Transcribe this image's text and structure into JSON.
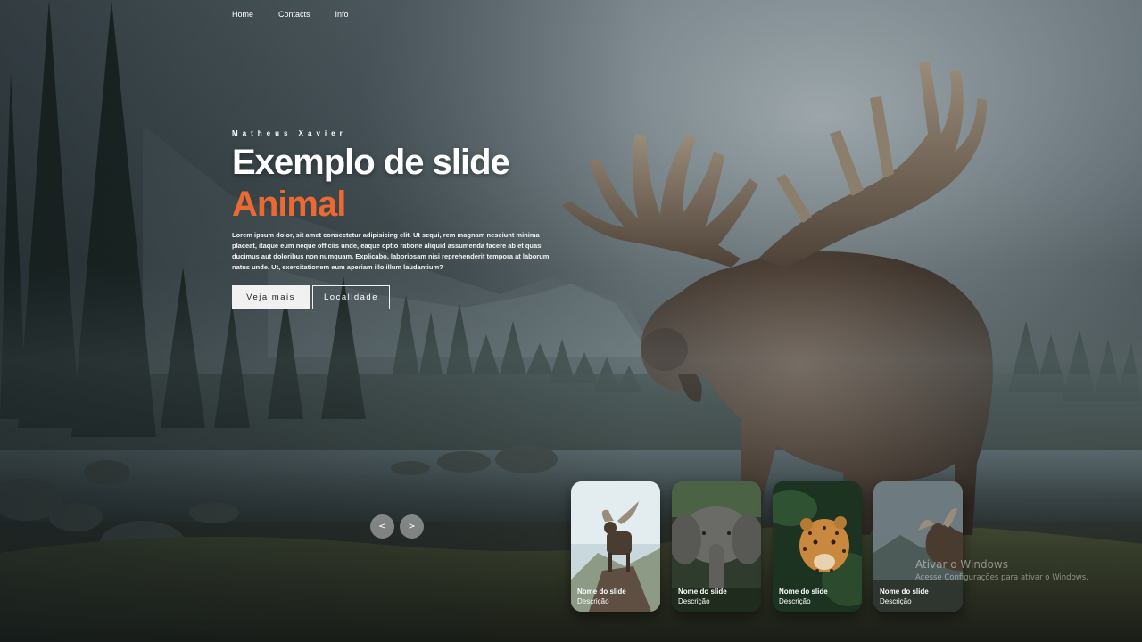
{
  "nav": {
    "items": [
      {
        "label": "Home"
      },
      {
        "label": "Contacts"
      },
      {
        "label": "Info"
      }
    ]
  },
  "hero": {
    "author": "Matheus Xavier",
    "title": "Exemplo de slide",
    "subtitle": "Animal",
    "description": "Lorem ipsum dolor, sit amet consectetur adipisicing elit. Ut sequi, rem magnam nesciunt minima placeat, itaque eum neque officiis unde, eaque optio ratione aliquid assumenda facere ab et quasi ducimus aut doloribus non numquam. Explicabo, laboriosam nisi reprehenderit tempora at laborum natus unde. Ut, exercitationem eum aperiam illo illum laudantium?",
    "primary_button": "Veja mais",
    "secondary_button": "Localidade",
    "accent_color": "#ec6a32"
  },
  "slider": {
    "prev_label": "<",
    "next_label": ">",
    "thumbnails": [
      {
        "name": "Nome do slide",
        "description": "Descrição",
        "image": "moose"
      },
      {
        "name": "Nome do slide",
        "description": "Descrição",
        "image": "elephant"
      },
      {
        "name": "Nome do slide",
        "description": "Descrição",
        "image": "jaguar"
      },
      {
        "name": "Nome do slide",
        "description": "Descrição",
        "image": "moose-antlers"
      }
    ]
  },
  "watermark": {
    "title": "Ativar o Windows",
    "subtitle": "Acesse Configurações para ativar o Windows."
  }
}
